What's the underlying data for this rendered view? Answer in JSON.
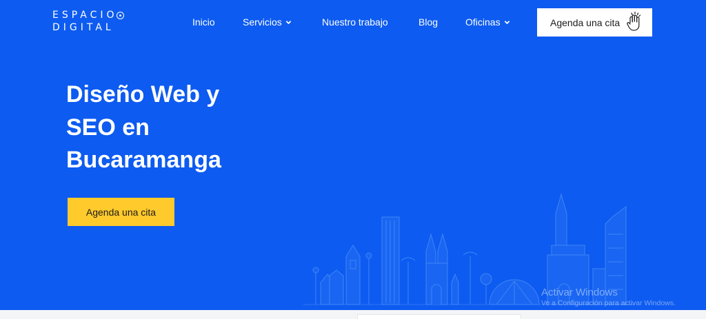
{
  "logo": {
    "line1": "ESPACIO",
    "line2": "DIGITAL"
  },
  "nav": {
    "items": [
      {
        "label": "Inicio",
        "has_dropdown": false
      },
      {
        "label": "Servicios",
        "has_dropdown": true
      },
      {
        "label": "Nuestro trabajo",
        "has_dropdown": false
      },
      {
        "label": "Blog",
        "has_dropdown": false
      },
      {
        "label": "Oficinas",
        "has_dropdown": true
      }
    ],
    "cta_label": "Agenda una cita"
  },
  "hero": {
    "title": "Diseño Web y SEO en Bucaramanga",
    "cta_label": "Agenda una cita"
  },
  "watermark": {
    "title": "Activar Windows",
    "subtitle": "Ve a Configuración para activar Windows."
  },
  "colors": {
    "hero_bg": "#0d5bf0",
    "cta_yellow": "#ffca2c",
    "cta_white": "#ffffff",
    "text_dark": "#1b1b1b"
  },
  "icons": [
    "logo-ring-icon",
    "chevron-down-icon",
    "waving-hand-icon",
    "city-skyline-illustration"
  ]
}
